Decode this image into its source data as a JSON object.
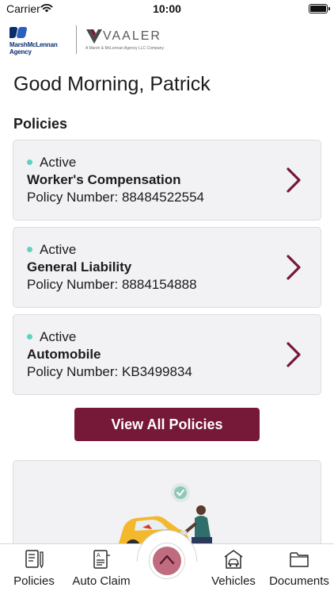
{
  "status_bar": {
    "carrier": "Carrier",
    "time": "10:00"
  },
  "branding": {
    "partner_logo_text": "MarshMcLennan Agency",
    "company_name": "VAALER",
    "company_tagline": "A Marsh & McLennan Agency LLC Company"
  },
  "greeting": "Good Morning, Patrick",
  "policies": {
    "section_title": "Policies",
    "items": [
      {
        "status": "Active",
        "name": "Worker's Compensation",
        "number": "Policy Number: 88484522554"
      },
      {
        "status": "Active",
        "name": "General Liability",
        "number": "Policy Number: 8884154888"
      },
      {
        "status": "Active",
        "name": "Automobile",
        "number": "Policy Number: KB3499834"
      }
    ],
    "view_all_label": "View All Policies"
  },
  "tabs": [
    {
      "label": "Policies",
      "icon": "document-pen-icon"
    },
    {
      "label": "Auto Claim",
      "icon": "claim-form-icon"
    },
    {
      "label": "Vehicles",
      "icon": "car-garage-icon"
    },
    {
      "label": "Documents",
      "icon": "folder-icon"
    }
  ],
  "colors": {
    "brand": "#761837",
    "active_status": "#5fd3c0",
    "card_background": "#f2f2f4",
    "center_button": "#c06c80"
  }
}
